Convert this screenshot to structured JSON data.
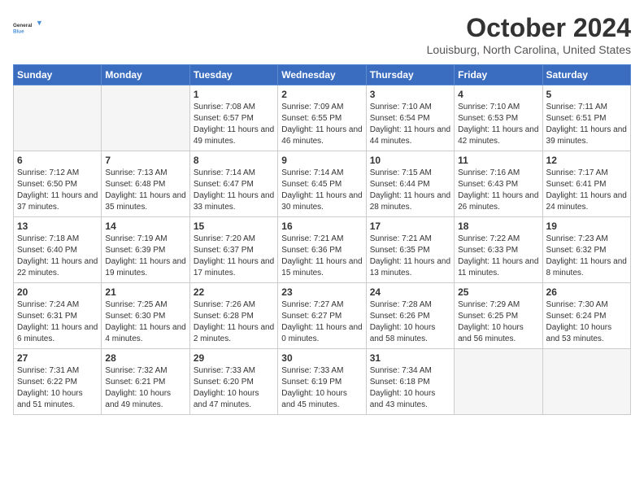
{
  "logo": {
    "line1": "General",
    "line2": "Blue"
  },
  "title": "October 2024",
  "location": "Louisburg, North Carolina, United States",
  "weekdays": [
    "Sunday",
    "Monday",
    "Tuesday",
    "Wednesday",
    "Thursday",
    "Friday",
    "Saturday"
  ],
  "weeks": [
    [
      {
        "num": "",
        "sunrise": "",
        "sunset": "",
        "daylight": ""
      },
      {
        "num": "",
        "sunrise": "",
        "sunset": "",
        "daylight": ""
      },
      {
        "num": "1",
        "sunrise": "Sunrise: 7:08 AM",
        "sunset": "Sunset: 6:57 PM",
        "daylight": "Daylight: 11 hours and 49 minutes."
      },
      {
        "num": "2",
        "sunrise": "Sunrise: 7:09 AM",
        "sunset": "Sunset: 6:55 PM",
        "daylight": "Daylight: 11 hours and 46 minutes."
      },
      {
        "num": "3",
        "sunrise": "Sunrise: 7:10 AM",
        "sunset": "Sunset: 6:54 PM",
        "daylight": "Daylight: 11 hours and 44 minutes."
      },
      {
        "num": "4",
        "sunrise": "Sunrise: 7:10 AM",
        "sunset": "Sunset: 6:53 PM",
        "daylight": "Daylight: 11 hours and 42 minutes."
      },
      {
        "num": "5",
        "sunrise": "Sunrise: 7:11 AM",
        "sunset": "Sunset: 6:51 PM",
        "daylight": "Daylight: 11 hours and 39 minutes."
      }
    ],
    [
      {
        "num": "6",
        "sunrise": "Sunrise: 7:12 AM",
        "sunset": "Sunset: 6:50 PM",
        "daylight": "Daylight: 11 hours and 37 minutes."
      },
      {
        "num": "7",
        "sunrise": "Sunrise: 7:13 AM",
        "sunset": "Sunset: 6:48 PM",
        "daylight": "Daylight: 11 hours and 35 minutes."
      },
      {
        "num": "8",
        "sunrise": "Sunrise: 7:14 AM",
        "sunset": "Sunset: 6:47 PM",
        "daylight": "Daylight: 11 hours and 33 minutes."
      },
      {
        "num": "9",
        "sunrise": "Sunrise: 7:14 AM",
        "sunset": "Sunset: 6:45 PM",
        "daylight": "Daylight: 11 hours and 30 minutes."
      },
      {
        "num": "10",
        "sunrise": "Sunrise: 7:15 AM",
        "sunset": "Sunset: 6:44 PM",
        "daylight": "Daylight: 11 hours and 28 minutes."
      },
      {
        "num": "11",
        "sunrise": "Sunrise: 7:16 AM",
        "sunset": "Sunset: 6:43 PM",
        "daylight": "Daylight: 11 hours and 26 minutes."
      },
      {
        "num": "12",
        "sunrise": "Sunrise: 7:17 AM",
        "sunset": "Sunset: 6:41 PM",
        "daylight": "Daylight: 11 hours and 24 minutes."
      }
    ],
    [
      {
        "num": "13",
        "sunrise": "Sunrise: 7:18 AM",
        "sunset": "Sunset: 6:40 PM",
        "daylight": "Daylight: 11 hours and 22 minutes."
      },
      {
        "num": "14",
        "sunrise": "Sunrise: 7:19 AM",
        "sunset": "Sunset: 6:39 PM",
        "daylight": "Daylight: 11 hours and 19 minutes."
      },
      {
        "num": "15",
        "sunrise": "Sunrise: 7:20 AM",
        "sunset": "Sunset: 6:37 PM",
        "daylight": "Daylight: 11 hours and 17 minutes."
      },
      {
        "num": "16",
        "sunrise": "Sunrise: 7:21 AM",
        "sunset": "Sunset: 6:36 PM",
        "daylight": "Daylight: 11 hours and 15 minutes."
      },
      {
        "num": "17",
        "sunrise": "Sunrise: 7:21 AM",
        "sunset": "Sunset: 6:35 PM",
        "daylight": "Daylight: 11 hours and 13 minutes."
      },
      {
        "num": "18",
        "sunrise": "Sunrise: 7:22 AM",
        "sunset": "Sunset: 6:33 PM",
        "daylight": "Daylight: 11 hours and 11 minutes."
      },
      {
        "num": "19",
        "sunrise": "Sunrise: 7:23 AM",
        "sunset": "Sunset: 6:32 PM",
        "daylight": "Daylight: 11 hours and 8 minutes."
      }
    ],
    [
      {
        "num": "20",
        "sunrise": "Sunrise: 7:24 AM",
        "sunset": "Sunset: 6:31 PM",
        "daylight": "Daylight: 11 hours and 6 minutes."
      },
      {
        "num": "21",
        "sunrise": "Sunrise: 7:25 AM",
        "sunset": "Sunset: 6:30 PM",
        "daylight": "Daylight: 11 hours and 4 minutes."
      },
      {
        "num": "22",
        "sunrise": "Sunrise: 7:26 AM",
        "sunset": "Sunset: 6:28 PM",
        "daylight": "Daylight: 11 hours and 2 minutes."
      },
      {
        "num": "23",
        "sunrise": "Sunrise: 7:27 AM",
        "sunset": "Sunset: 6:27 PM",
        "daylight": "Daylight: 11 hours and 0 minutes."
      },
      {
        "num": "24",
        "sunrise": "Sunrise: 7:28 AM",
        "sunset": "Sunset: 6:26 PM",
        "daylight": "Daylight: 10 hours and 58 minutes."
      },
      {
        "num": "25",
        "sunrise": "Sunrise: 7:29 AM",
        "sunset": "Sunset: 6:25 PM",
        "daylight": "Daylight: 10 hours and 56 minutes."
      },
      {
        "num": "26",
        "sunrise": "Sunrise: 7:30 AM",
        "sunset": "Sunset: 6:24 PM",
        "daylight": "Daylight: 10 hours and 53 minutes."
      }
    ],
    [
      {
        "num": "27",
        "sunrise": "Sunrise: 7:31 AM",
        "sunset": "Sunset: 6:22 PM",
        "daylight": "Daylight: 10 hours and 51 minutes."
      },
      {
        "num": "28",
        "sunrise": "Sunrise: 7:32 AM",
        "sunset": "Sunset: 6:21 PM",
        "daylight": "Daylight: 10 hours and 49 minutes."
      },
      {
        "num": "29",
        "sunrise": "Sunrise: 7:33 AM",
        "sunset": "Sunset: 6:20 PM",
        "daylight": "Daylight: 10 hours and 47 minutes."
      },
      {
        "num": "30",
        "sunrise": "Sunrise: 7:33 AM",
        "sunset": "Sunset: 6:19 PM",
        "daylight": "Daylight: 10 hours and 45 minutes."
      },
      {
        "num": "31",
        "sunrise": "Sunrise: 7:34 AM",
        "sunset": "Sunset: 6:18 PM",
        "daylight": "Daylight: 10 hours and 43 minutes."
      },
      {
        "num": "",
        "sunrise": "",
        "sunset": "",
        "daylight": ""
      },
      {
        "num": "",
        "sunrise": "",
        "sunset": "",
        "daylight": ""
      }
    ]
  ]
}
